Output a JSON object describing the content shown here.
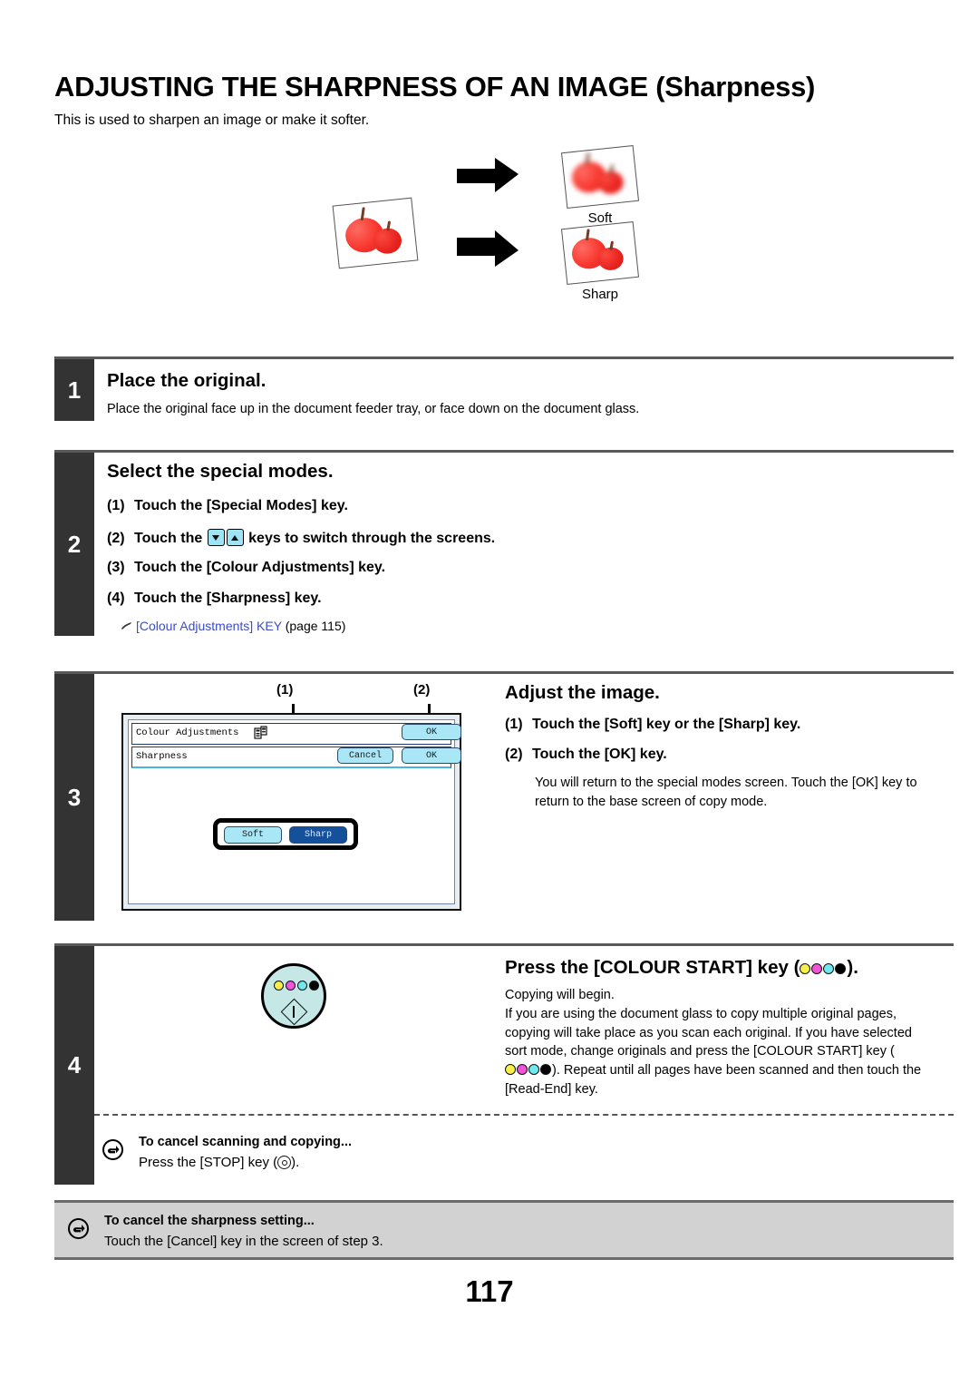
{
  "header": {
    "title": "ADJUSTING THE SHARPNESS OF AN IMAGE (Sharpness)",
    "subtitle": "This is used to sharpen an image or make it softer."
  },
  "illustration": {
    "label_soft": "Soft",
    "label_sharp": "Sharp"
  },
  "steps": [
    {
      "number": "1",
      "heading": "Place the original.",
      "body": "Place the original face up in the document feeder tray, or face down on the document glass."
    },
    {
      "number": "2",
      "heading": "Select the special modes.",
      "items": [
        {
          "num": "(1)",
          "text_before": "Touch the [Special Modes] key.",
          "text_after": ""
        },
        {
          "num": "(2)",
          "text_before": "Touch the ",
          "text_after": " keys to switch through the screens."
        },
        {
          "num": "(3)",
          "text_before": "Touch the [Colour Adjustments] key.",
          "text_after": ""
        },
        {
          "num": "(4)",
          "text_before": "Touch the [Sharpness] key.",
          "text_after": ""
        }
      ],
      "reference_link": "[Colour Adjustments] KEY",
      "reference_page": "(page 115)"
    },
    {
      "number": "3",
      "heading": "Adjust the image.",
      "items": [
        {
          "num": "(1)",
          "text": "Touch the [Soft] key or the [Sharp] key."
        },
        {
          "num": "(2)",
          "text": "Touch the [OK] key."
        }
      ],
      "body": "You will return to the special modes screen. Touch the [OK] key to return to the base screen of copy mode."
    },
    {
      "number": "4",
      "heading_before": "Press the [COLOUR START] key (",
      "heading_after": ").",
      "body_line1": "Copying will begin.",
      "body_line2_a": "If you are using the document glass to copy multiple original pages, copying will take place as you scan each original. If you have selected sort mode, change originals and press the [COLOUR START] key (",
      "body_line2_b": "). Repeat until all pages have been scanned and then touch the [Read-End] key."
    }
  ],
  "panel": {
    "callout_1": "(1)",
    "callout_2": "(2)",
    "title_row1": "Colour Adjustments",
    "title_row2": "Sharpness",
    "btn_ok_top": "OK",
    "btn_cancel": "Cancel",
    "btn_ok_bottom": "OK",
    "btn_soft": "Soft",
    "btn_sharp": "Sharp"
  },
  "notes": [
    {
      "title": "To cancel scanning and copying...",
      "text_before": "Press the [STOP] key (",
      "text_after": ")."
    },
    {
      "title": "To cancel the sharpness setting...",
      "text": "Touch the [Cancel] key in the screen of step 3."
    }
  ],
  "page_number": "117",
  "colors": {
    "cyan_key": "#a9e6f6",
    "selected_blue": "#15509b",
    "step_bar": "#333333",
    "link": "#3b4cc8",
    "cmyk_yellow": "#f7ef4a",
    "cmyk_magenta": "#f253d8",
    "cmyk_cyan": "#6fe9ef",
    "cmyk_black": "#000000",
    "start_button": "#c5e7e6"
  }
}
